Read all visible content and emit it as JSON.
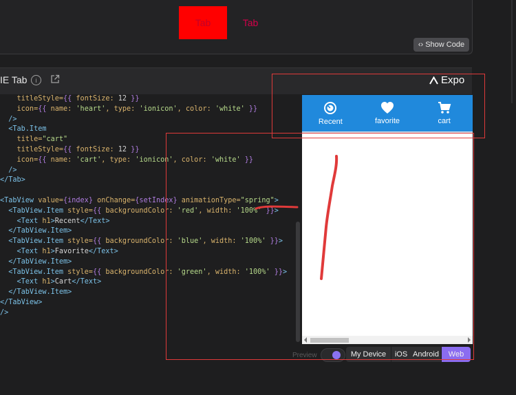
{
  "preview_tabs": {
    "tab_1": "Tab",
    "tab_2": "Tab"
  },
  "show_code": {
    "label": "Show Code",
    "icon": "code-brackets-icon"
  },
  "snack_header": {
    "title": "IE Tab",
    "info_icon": "info-icon",
    "open_icon": "external-link-icon"
  },
  "platform": {
    "expo_label": "Expo",
    "logo_icon": "expo-chevron-icon"
  },
  "code_lines": [
    [
      [
        "    titleStyle=",
        "attr"
      ],
      [
        "{{ ",
        "brace"
      ],
      [
        "fontSize: ",
        "attr"
      ],
      [
        "12",
        "plain"
      ],
      [
        " }}",
        "brace"
      ]
    ],
    [
      [
        "    icon=",
        "attr"
      ],
      [
        "{{ ",
        "brace"
      ],
      [
        "name: ",
        "attr"
      ],
      [
        "'heart'",
        "str"
      ],
      [
        ", type: ",
        "attr"
      ],
      [
        "'ionicon'",
        "str"
      ],
      [
        ", color: ",
        "attr"
      ],
      [
        "'white'",
        "str"
      ],
      [
        " }}",
        "brace"
      ]
    ],
    [
      [
        "  />",
        "tag"
      ]
    ],
    [
      [
        "  <Tab.Item",
        "tag"
      ]
    ],
    [
      [
        "    title=",
        "attr"
      ],
      [
        "\"cart\"",
        "str"
      ]
    ],
    [
      [
        "    titleStyle=",
        "attr"
      ],
      [
        "{{ ",
        "brace"
      ],
      [
        "fontSize: ",
        "attr"
      ],
      [
        "12",
        "plain"
      ],
      [
        " }}",
        "brace"
      ]
    ],
    [
      [
        "    icon=",
        "attr"
      ],
      [
        "{{ ",
        "brace"
      ],
      [
        "name: ",
        "attr"
      ],
      [
        "'cart'",
        "str"
      ],
      [
        ", type: ",
        "attr"
      ],
      [
        "'ionicon'",
        "str"
      ],
      [
        ", color: ",
        "attr"
      ],
      [
        "'white'",
        "str"
      ],
      [
        " }}",
        "brace"
      ]
    ],
    [
      [
        "  />",
        "tag"
      ]
    ],
    [
      [
        "</Tab>",
        "tag"
      ]
    ],
    [
      [
        "",
        "plain"
      ]
    ],
    [
      [
        "<TabView ",
        "tag"
      ],
      [
        "value=",
        "attr"
      ],
      [
        "{index}",
        "brace"
      ],
      [
        " onChange=",
        "attr"
      ],
      [
        "{setIndex}",
        "brace"
      ],
      [
        " animationType=",
        "attr"
      ],
      [
        "\"spring\"",
        "str"
      ],
      [
        ">",
        "tag"
      ]
    ],
    [
      [
        "  <TabView.Item ",
        "tag"
      ],
      [
        "style=",
        "attr"
      ],
      [
        "{{ ",
        "brace"
      ],
      [
        "backgroundColor: ",
        "attr"
      ],
      [
        "'red'",
        "str"
      ],
      [
        ", width: ",
        "attr"
      ],
      [
        "'100%'",
        "str"
      ],
      [
        " }}",
        "brace"
      ],
      [
        ">",
        "tag"
      ]
    ],
    [
      [
        "    <Text ",
        "tag"
      ],
      [
        "h1",
        "attr"
      ],
      [
        ">",
        "tag"
      ],
      [
        "Recent",
        "plain"
      ],
      [
        "</Text>",
        "tag"
      ]
    ],
    [
      [
        "  </TabView.Item>",
        "tag"
      ]
    ],
    [
      [
        "  <TabView.Item ",
        "tag"
      ],
      [
        "style=",
        "attr"
      ],
      [
        "{{ ",
        "brace"
      ],
      [
        "backgroundColor: ",
        "attr"
      ],
      [
        "'blue'",
        "str"
      ],
      [
        ", width: ",
        "attr"
      ],
      [
        "'100%'",
        "str"
      ],
      [
        " }}",
        "brace"
      ],
      [
        ">",
        "tag"
      ]
    ],
    [
      [
        "    <Text ",
        "tag"
      ],
      [
        "h1",
        "attr"
      ],
      [
        ">",
        "tag"
      ],
      [
        "Favorite",
        "plain"
      ],
      [
        "</Text>",
        "tag"
      ]
    ],
    [
      [
        "  </TabView.Item>",
        "tag"
      ]
    ],
    [
      [
        "  <TabView.Item ",
        "tag"
      ],
      [
        "style=",
        "attr"
      ],
      [
        "{{ ",
        "brace"
      ],
      [
        "backgroundColor: ",
        "attr"
      ],
      [
        "'green'",
        "str"
      ],
      [
        ", width: ",
        "attr"
      ],
      [
        "'100%'",
        "str"
      ],
      [
        " }}",
        "brace"
      ],
      [
        ">",
        "tag"
      ]
    ],
    [
      [
        "    <Text ",
        "tag"
      ],
      [
        "h1",
        "attr"
      ],
      [
        ">",
        "tag"
      ],
      [
        "Cart",
        "plain"
      ],
      [
        "</Text>",
        "tag"
      ]
    ],
    [
      [
        "  </TabView.Item>",
        "tag"
      ]
    ],
    [
      [
        "</TabView>",
        "tag"
      ]
    ],
    [
      [
        "/>",
        "tag"
      ]
    ]
  ],
  "device": {
    "tabs": [
      {
        "label": "Recent",
        "icon": "clock-icon"
      },
      {
        "label": "favorite",
        "icon": "heart-icon"
      },
      {
        "label": "cart",
        "icon": "cart-icon"
      }
    ],
    "header_color": "#2089dc"
  },
  "preview_controls": {
    "preview_label": "Preview",
    "toggle_on": true,
    "segments": [
      {
        "label": "My Device",
        "active": false
      },
      {
        "label": "iOS",
        "active": false
      },
      {
        "label": "Android",
        "active": false
      },
      {
        "label": "Web",
        "active": true
      }
    ]
  },
  "annotations": {
    "color": "#e03a3a"
  }
}
